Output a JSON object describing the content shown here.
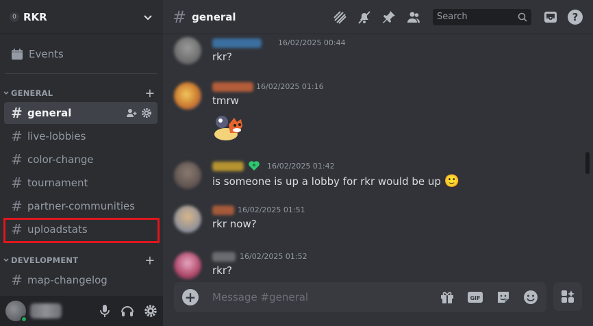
{
  "server": {
    "name": "RKR",
    "badge": "0"
  },
  "sidebar": {
    "events_label": "Events",
    "categories": [
      {
        "label": "GENERAL"
      },
      {
        "label": "DEVELOPMENT"
      }
    ],
    "channels": [
      {
        "name": "general"
      },
      {
        "name": "live-lobbies"
      },
      {
        "name": "color-change"
      },
      {
        "name": "tournament"
      },
      {
        "name": "partner-communities"
      },
      {
        "name": "uploadstats"
      },
      {
        "name": "map-changelog"
      }
    ]
  },
  "topbar": {
    "channel": "general",
    "search_placeholder": "Search"
  },
  "messages": [
    {
      "time": "16/02/2025 00:44",
      "text": "rkr?"
    },
    {
      "time": "16/02/2025 01:16",
      "text": "tmrw"
    },
    {
      "time": "16/02/2025 01:42",
      "text": "is someone is up a lobby for rkr would be up",
      "emoji": "🙂"
    },
    {
      "time": "16/02/2025 01:51",
      "text": "rkr now?"
    },
    {
      "time": "16/02/2025 01:52",
      "text": "rkr?"
    }
  ],
  "composer": {
    "placeholder": "Message #general"
  },
  "colors": {
    "accent_highlight": "#e0161d",
    "status_online": "#23a55a"
  }
}
